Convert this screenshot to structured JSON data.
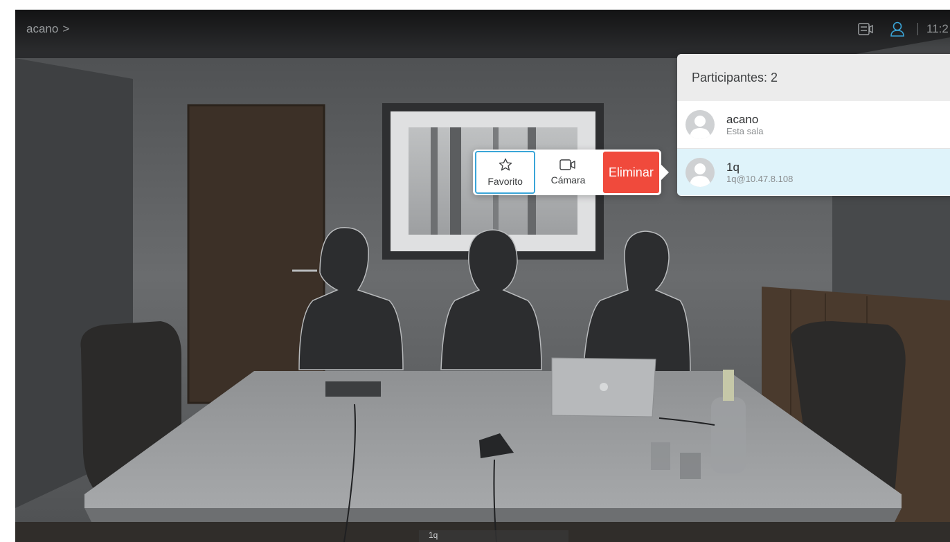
{
  "call": {
    "room_name": "acano",
    "chevron": ">",
    "clock": "11:2"
  },
  "status_icons": [
    "layout-icon",
    "participants-icon"
  ],
  "participants_panel": {
    "title": "Participantes: 2",
    "participants": [
      {
        "name": "acano",
        "detail": "Esta sala",
        "selected": false
      },
      {
        "name": "1q",
        "detail": "1q@10.47.8.108",
        "selected": true
      }
    ]
  },
  "actions": {
    "favorite_label": "Favorito",
    "camera_label": "Cámara",
    "remove_label": "Eliminar"
  },
  "self_view_label": "1q",
  "colors": {
    "accent_blue": "#3aa5d8",
    "remove_red": "#f04a3c",
    "selected_row": "#dff3fa",
    "panel_header": "#ececec"
  }
}
